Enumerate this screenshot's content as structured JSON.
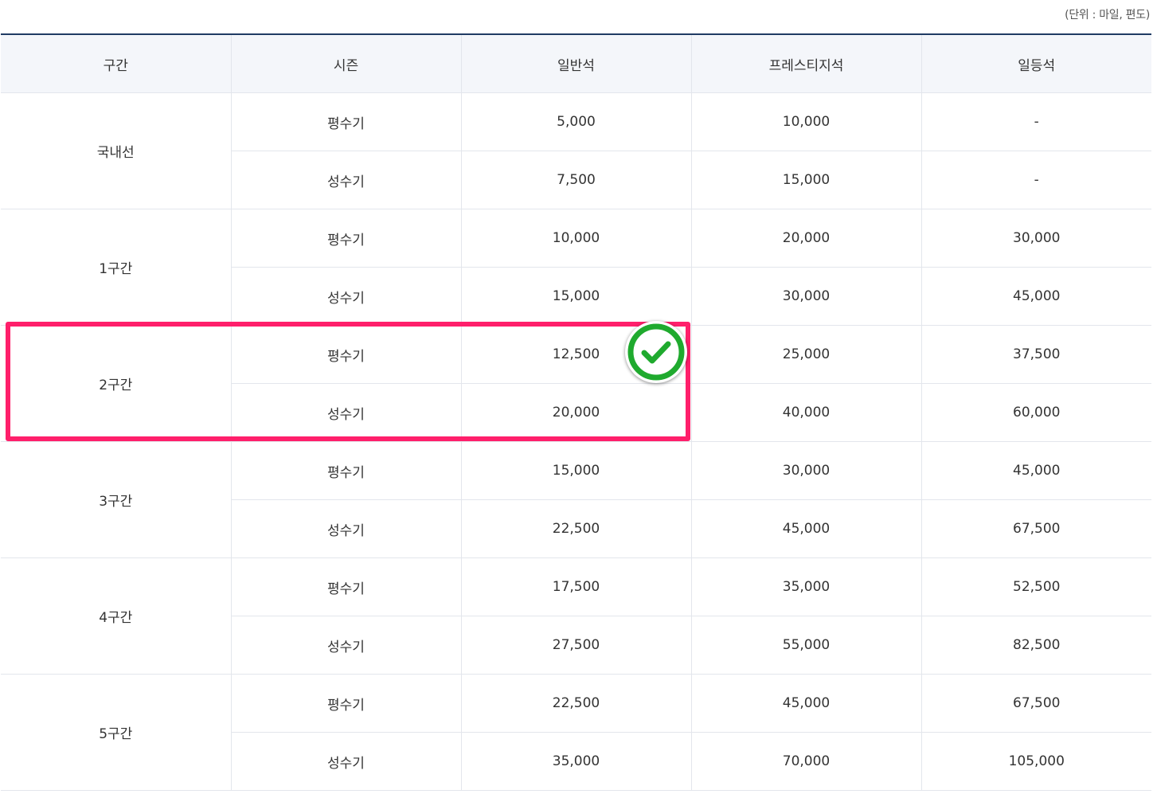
{
  "unit_note": "(단위 : 마일, 편도)",
  "headers": {
    "zone": "구간",
    "season": "시즌",
    "economy": "일반석",
    "prestige": "프레스티지석",
    "first": "일등석"
  },
  "rows": [
    {
      "zone": "국내선",
      "seasons": [
        {
          "season": "평수기",
          "economy": "5,000",
          "prestige": "10,000",
          "first": "-"
        },
        {
          "season": "성수기",
          "economy": "7,500",
          "prestige": "15,000",
          "first": "-"
        }
      ]
    },
    {
      "zone": "1구간",
      "seasons": [
        {
          "season": "평수기",
          "economy": "10,000",
          "prestige": "20,000",
          "first": "30,000"
        },
        {
          "season": "성수기",
          "economy": "15,000",
          "prestige": "30,000",
          "first": "45,000"
        }
      ]
    },
    {
      "zone": "2구간",
      "seasons": [
        {
          "season": "평수기",
          "economy": "12,500",
          "prestige": "25,000",
          "first": "37,500"
        },
        {
          "season": "성수기",
          "economy": "20,000",
          "prestige": "40,000",
          "first": "60,000"
        }
      ]
    },
    {
      "zone": "3구간",
      "seasons": [
        {
          "season": "평수기",
          "economy": "15,000",
          "prestige": "30,000",
          "first": "45,000"
        },
        {
          "season": "성수기",
          "economy": "22,500",
          "prestige": "45,000",
          "first": "67,500"
        }
      ]
    },
    {
      "zone": "4구간",
      "seasons": [
        {
          "season": "평수기",
          "economy": "17,500",
          "prestige": "35,000",
          "first": "52,500"
        },
        {
          "season": "성수기",
          "economy": "27,500",
          "prestige": "55,000",
          "first": "82,500"
        }
      ]
    },
    {
      "zone": "5구간",
      "seasons": [
        {
          "season": "평수기",
          "economy": "22,500",
          "prestige": "45,000",
          "first": "67,500"
        },
        {
          "season": "성수기",
          "economy": "35,000",
          "prestige": "70,000",
          "first": "105,000"
        }
      ]
    }
  ],
  "annotation": {
    "highlight_color": "#ff1f6b",
    "check_icon": "check-circle-icon",
    "check_color": "#1faa2e"
  }
}
